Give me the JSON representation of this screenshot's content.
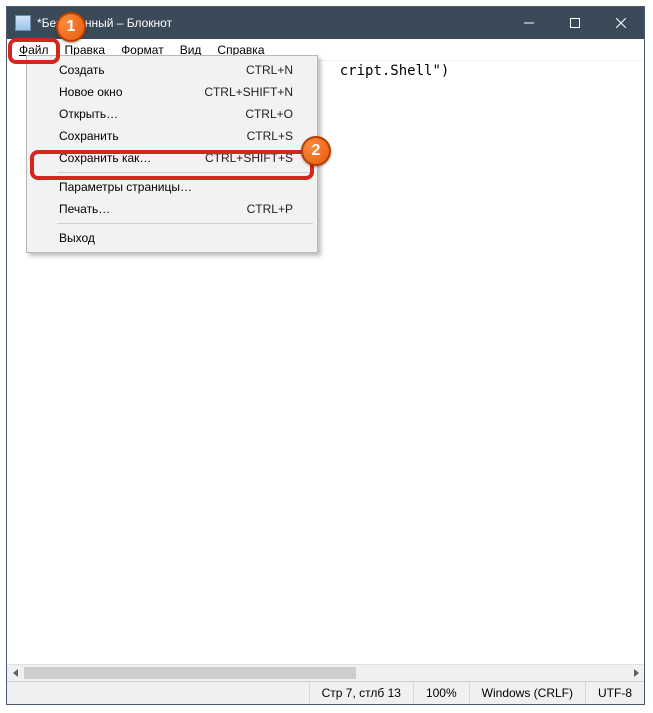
{
  "title": "*Безымянный – Блокнот",
  "menu": {
    "file": "Файл",
    "edit": "Правка",
    "format": "Формат",
    "view": "Вид",
    "help": "Справка"
  },
  "file_menu": {
    "new": {
      "label": "Создать",
      "shortcut": "CTRL+N"
    },
    "new_window": {
      "label": "Новое окно",
      "shortcut": "CTRL+SHIFT+N"
    },
    "open": {
      "label": "Открыть…",
      "shortcut": "CTRL+O"
    },
    "save": {
      "label": "Сохранить",
      "shortcut": "CTRL+S"
    },
    "save_as": {
      "label": "Сохранить как…",
      "shortcut": "CTRL+SHIFT+S"
    },
    "page_setup": {
      "label": "Параметры страницы…",
      "shortcut": ""
    },
    "print": {
      "label": "Печать…",
      "shortcut": "CTRL+P"
    },
    "exit": {
      "label": "Выход",
      "shortcut": ""
    }
  },
  "editor_visible_text": "cript.Shell\")",
  "status": {
    "position": "Стр 7, стлб 13",
    "zoom": "100%",
    "line_ending": "Windows (CRLF)",
    "encoding": "UTF-8"
  },
  "annotations": {
    "1": "1",
    "2": "2"
  }
}
